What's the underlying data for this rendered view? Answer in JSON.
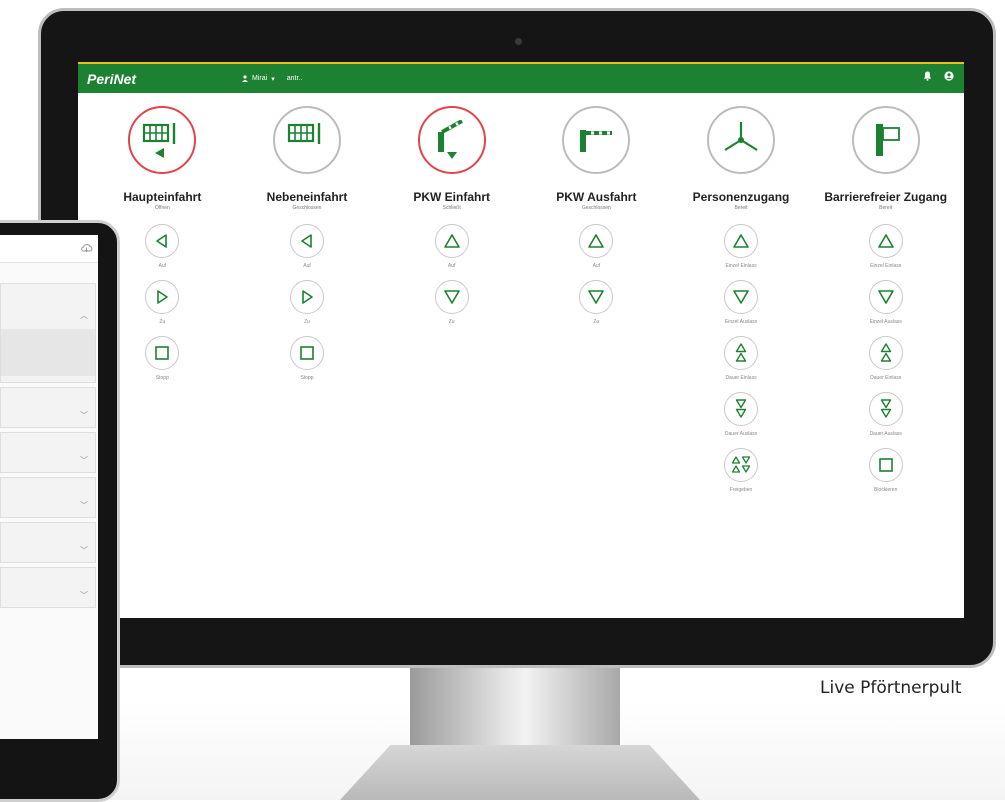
{
  "app": {
    "logo": "PeriNet",
    "user_menu": "Mirai",
    "user_secondary": "antr..",
    "icons": [
      "bell-icon",
      "user-circle-icon"
    ],
    "accent_green": "#1d8132",
    "accent_yellow": "#e5c21e",
    "alert_red": "#e0444c"
  },
  "gates": [
    {
      "name": "Haupteinfahrt",
      "status": "Öffnen",
      "icon": "sliding-gate-icon",
      "alert": true,
      "actions": [
        {
          "icon": "arrow-left-icon",
          "label": "Auf"
        },
        {
          "icon": "arrow-right-icon",
          "label": "Zu"
        },
        {
          "icon": "stop-icon",
          "label": "Stopp"
        }
      ]
    },
    {
      "name": "Nebeneinfahrt",
      "status": "Geschlossen",
      "icon": "sliding-gate-icon",
      "alert": false,
      "actions": [
        {
          "icon": "arrow-left-icon",
          "label": "Auf"
        },
        {
          "icon": "arrow-right-icon",
          "label": "Zu"
        },
        {
          "icon": "stop-icon",
          "label": "Stopp"
        }
      ]
    },
    {
      "name": "PKW Einfahrt",
      "status": "Schließt",
      "icon": "barrier-icon",
      "alert": true,
      "actions": [
        {
          "icon": "arrow-up-icon",
          "label": "Auf"
        },
        {
          "icon": "arrow-down-icon",
          "label": "Zu"
        }
      ]
    },
    {
      "name": "PKW Ausfahrt",
      "status": "Geschlossen",
      "icon": "barrier-icon",
      "alert": false,
      "actions": [
        {
          "icon": "arrow-up-icon",
          "label": "Auf"
        },
        {
          "icon": "arrow-down-icon",
          "label": "Zu"
        }
      ]
    },
    {
      "name": "Personenzugang",
      "status": "Bereit",
      "icon": "turnstile-icon",
      "alert": false,
      "actions": [
        {
          "icon": "arrow-up-icon",
          "label": "Einzel Einlass"
        },
        {
          "icon": "arrow-down-icon",
          "label": "Einzel Auslass"
        },
        {
          "icon": "double-arrow-up-icon",
          "label": "Dauer Einlass"
        },
        {
          "icon": "double-arrow-down-icon",
          "label": "Dauer Auslass"
        },
        {
          "icon": "release-arrows-icon",
          "label": "Freigeben"
        }
      ]
    },
    {
      "name": "Barrierefreier Zugang",
      "status": "Bereit",
      "icon": "door-icon",
      "alert": false,
      "actions": [
        {
          "icon": "arrow-up-icon",
          "label": "Einzel Einlass"
        },
        {
          "icon": "arrow-down-icon",
          "label": "Einzel Auslass"
        },
        {
          "icon": "double-arrow-up-icon",
          "label": "Dauer Einlass"
        },
        {
          "icon": "double-arrow-down-icon",
          "label": "Dauer Auslass"
        },
        {
          "icon": "stop-icon",
          "label": "Blockieren"
        }
      ]
    }
  ],
  "caption": "Live Pförtnerpult",
  "tablet": {
    "header_icon": "cloud-sync-icon"
  }
}
